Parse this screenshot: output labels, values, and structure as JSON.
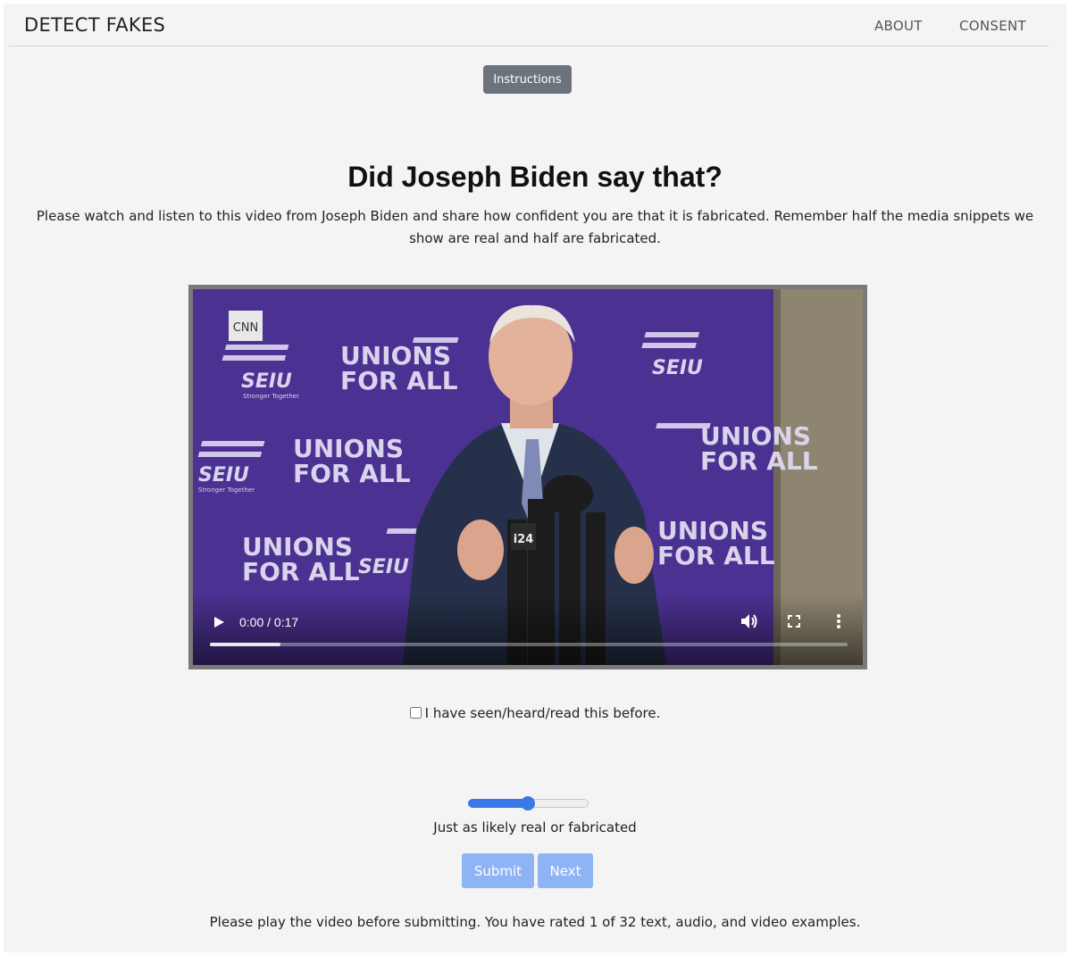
{
  "nav": {
    "brand": "DETECT FAKES",
    "links": [
      "ABOUT",
      "CONSENT"
    ]
  },
  "instructions_label": "Instructions",
  "question": "Did Joseph Biden say that?",
  "description": "Please watch and listen to this video from Joseph Biden and share how confident you are that it is fabricated. Remember half the media snippets we show are real and half are fabricated.",
  "video": {
    "time_display": "0:00 / 0:17",
    "progress_fraction": 0.11,
    "overlay_text": {
      "network_logo": "CNN",
      "mic_logo": "i24",
      "banner_union": "UNIONS",
      "banner_for_all": "FOR ALL",
      "banner_seiu": "SEIU",
      "banner_tagline": "Stronger Together"
    },
    "icons": [
      "play-icon",
      "volume-icon",
      "fullscreen-icon",
      "more-options-icon"
    ]
  },
  "seen_before": {
    "label": "I have seen/heard/read this before.",
    "checked": false
  },
  "confidence": {
    "value_fraction": 0.5,
    "label": "Just as likely real or fabricated"
  },
  "buttons": {
    "submit": "Submit",
    "next": "Next"
  },
  "footer_note": "Please play the video before submitting. You have rated 1 of 32 text, audio, and video examples.",
  "colors": {
    "page_bg": "#f4f4f4",
    "instructions_bg": "#6b747d",
    "button_blue": "#8fb4f6",
    "slider_blue": "#3b78e7",
    "backdrop_purple": "#4a2f8c"
  }
}
